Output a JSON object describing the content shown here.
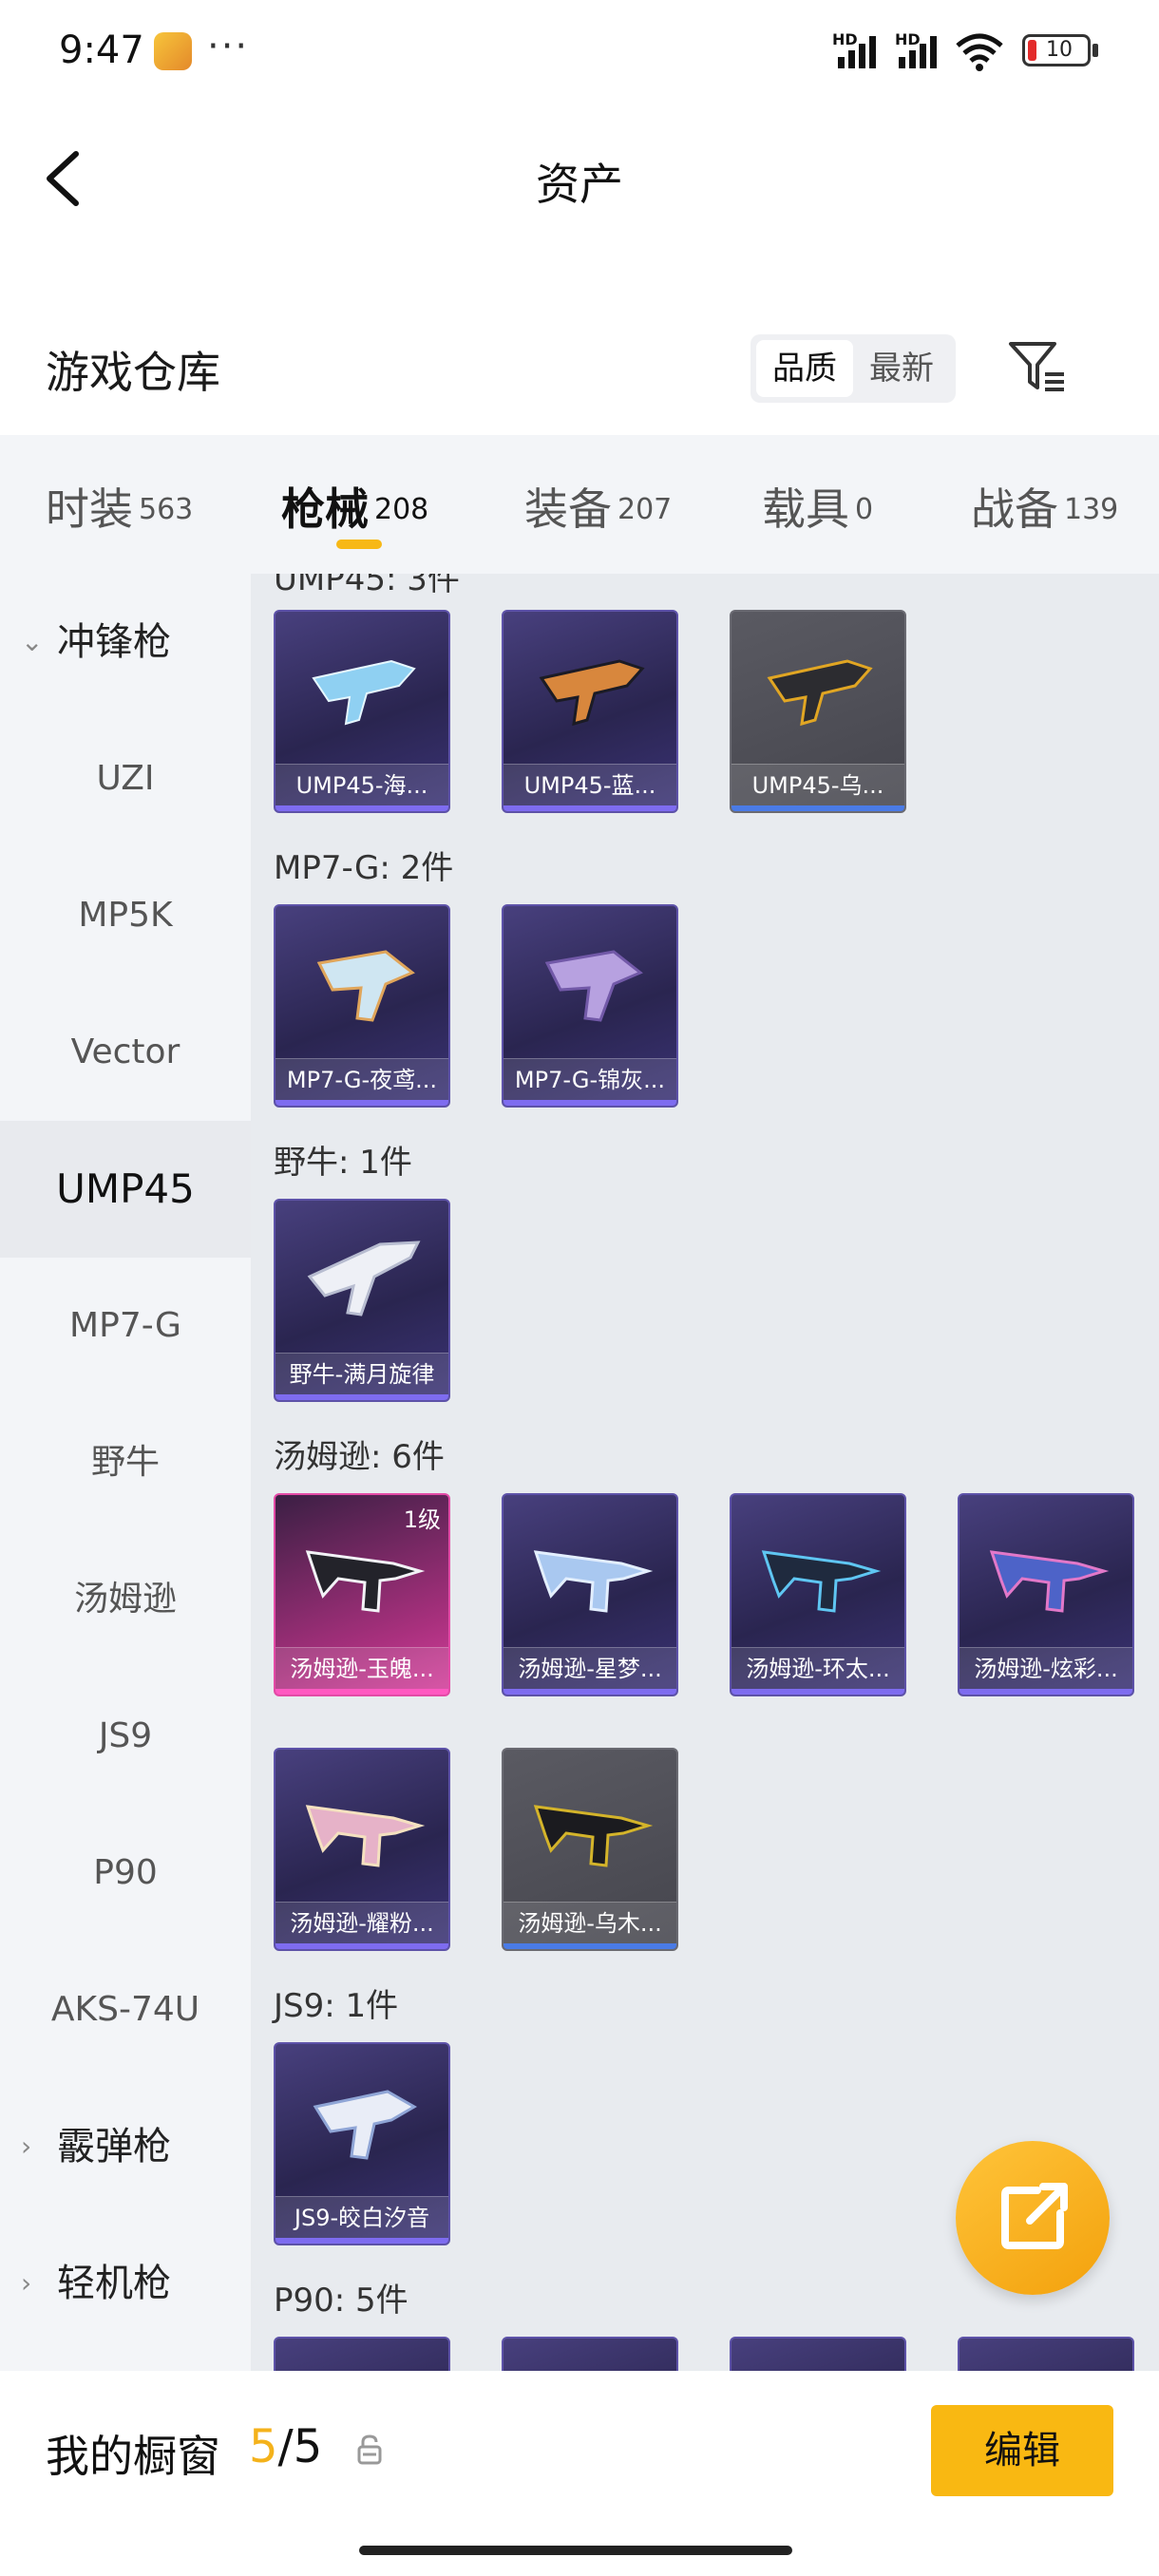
{
  "status_bar": {
    "time": "9:47",
    "more": "···",
    "battery": "10"
  },
  "header": {
    "title": "资产"
  },
  "section": {
    "title": "游戏仓库",
    "sort_options": [
      "品质",
      "最新"
    ]
  },
  "tabs": [
    {
      "label": "时装",
      "count": "563"
    },
    {
      "label": "枪械",
      "count": "208"
    },
    {
      "label": "装备",
      "count": "207"
    },
    {
      "label": "载具",
      "count": "0"
    },
    {
      "label": "战备",
      "count": "139"
    }
  ],
  "sidebar": {
    "groups": [
      {
        "label": "冲锋枪",
        "state": "expanded"
      },
      {
        "label": "霰弹枪",
        "state": "collapsed"
      },
      {
        "label": "轻机枪",
        "state": "collapsed"
      }
    ],
    "items": [
      "UZI",
      "MP5K",
      "Vector",
      "UMP45",
      "MP7-G",
      "野牛",
      "汤姆逊",
      "JS9",
      "P90",
      "AKS-74U"
    ],
    "active": "UMP45"
  },
  "content": {
    "groups": [
      {
        "title": "UMP45: 3件",
        "items": [
          {
            "name": "UMP45-海...",
            "rarity": "purple"
          },
          {
            "name": "UMP45-蓝...",
            "rarity": "purple"
          },
          {
            "name": "UMP45-乌...",
            "rarity": "grey"
          }
        ]
      },
      {
        "title": "MP7-G: 2件",
        "items": [
          {
            "name": "MP7-G-夜鸢...",
            "rarity": "purple"
          },
          {
            "name": "MP7-G-锦灰...",
            "rarity": "purple"
          }
        ]
      },
      {
        "title": "野牛: 1件",
        "items": [
          {
            "name": "野牛-满月旋律",
            "rarity": "purple"
          }
        ]
      },
      {
        "title": "汤姆逊: 6件",
        "items": [
          {
            "name": "汤姆逊-玉魄...",
            "rarity": "pink",
            "level": "1级"
          },
          {
            "name": "汤姆逊-星梦...",
            "rarity": "purple"
          },
          {
            "name": "汤姆逊-环太...",
            "rarity": "purple"
          },
          {
            "name": "汤姆逊-炫彩...",
            "rarity": "purple"
          },
          {
            "name": "汤姆逊-耀粉...",
            "rarity": "purple"
          },
          {
            "name": "汤姆逊-乌木...",
            "rarity": "grey"
          }
        ]
      },
      {
        "title": "JS9: 1件",
        "items": [
          {
            "name": "JS9-皎白汐音",
            "rarity": "purple"
          }
        ]
      },
      {
        "title": "P90: 5件",
        "items": []
      }
    ]
  },
  "bottom_bar": {
    "showcase_label": "我的橱窗",
    "showcase_current": "5",
    "showcase_total": "/5",
    "edit_label": "编辑"
  },
  "colors": {
    "accent": "#f9b812",
    "purple_card": "#2a2550",
    "pink_card": "#d53f9c",
    "grey_card": "#4a4a52"
  }
}
